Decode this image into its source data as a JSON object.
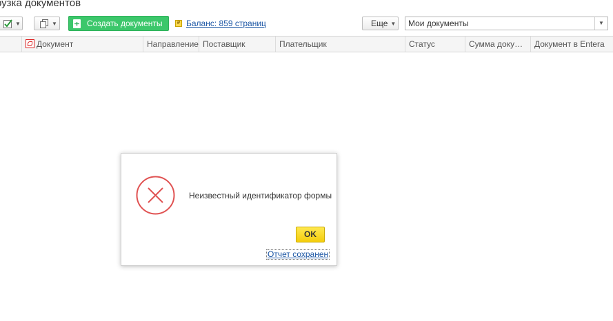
{
  "page": {
    "title": "рузка документов"
  },
  "toolbar": {
    "create_label": "Создать документы",
    "balance_label": "Баланс: 859 страниц",
    "more_label": "Еще",
    "filter_value": "Мои документы"
  },
  "table": {
    "columns": [
      "Документ",
      "Направление",
      "Поставщик",
      "Плательщик",
      "Статус",
      "Сумма доку…",
      "Документ в Entera"
    ]
  },
  "dialog": {
    "message": "Неизвестный идентификатор формы",
    "ok_label": "OK",
    "report_link": "Отчет сохранен"
  },
  "colors": {
    "create_button": "#3cc76b",
    "ok_button": "#f4cd0c",
    "error_icon": "#e05252",
    "link": "#1a55a4"
  },
  "icons": [
    "checkmark-icon",
    "copy-icon",
    "document-add-icon",
    "coin-icon",
    "pdf-icon",
    "error-icon"
  ]
}
